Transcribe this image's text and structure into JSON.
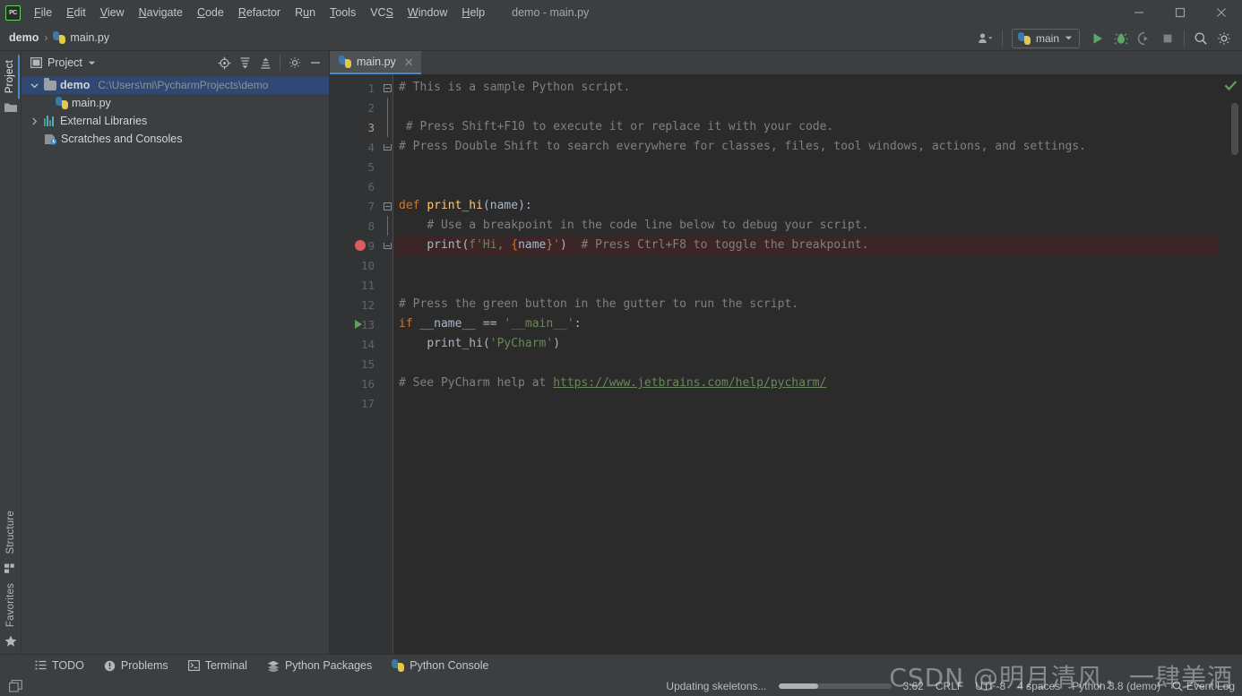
{
  "window": {
    "title": "demo - main.py",
    "logo_text": "PC",
    "controls": [
      {
        "name": "minimize",
        "label": "—"
      },
      {
        "name": "maximize",
        "label": "□"
      },
      {
        "name": "close",
        "label": "✕"
      }
    ]
  },
  "menu": {
    "items": [
      {
        "label": "File",
        "mnemonic": "F"
      },
      {
        "label": "Edit",
        "mnemonic": "E"
      },
      {
        "label": "View",
        "mnemonic": "V"
      },
      {
        "label": "Navigate",
        "mnemonic": "N"
      },
      {
        "label": "Code",
        "mnemonic": "C"
      },
      {
        "label": "Refactor",
        "mnemonic": "R"
      },
      {
        "label": "Run",
        "mnemonic": "u"
      },
      {
        "label": "Tools",
        "mnemonic": "T"
      },
      {
        "label": "VCS",
        "mnemonic": "S"
      },
      {
        "label": "Window",
        "mnemonic": "W"
      },
      {
        "label": "Help",
        "mnemonic": "H"
      }
    ]
  },
  "breadcrumb": {
    "project": "demo",
    "separator": "›",
    "file": "main.py"
  },
  "toolbar": {
    "run_config": "main",
    "buttons": [
      {
        "name": "user-accounts-button",
        "label": "Accounts"
      },
      {
        "name": "run-button",
        "label": "Run"
      },
      {
        "name": "debug-button",
        "label": "Debug"
      },
      {
        "name": "run-with-coverage-button",
        "label": "Run with Coverage"
      },
      {
        "name": "stop-button",
        "label": "Stop"
      },
      {
        "name": "search-everywhere-button",
        "label": "Search Everywhere"
      },
      {
        "name": "settings-button",
        "label": "Settings"
      }
    ]
  },
  "left_rail": {
    "top_tab": "Project",
    "bottom_tabs": [
      "Structure",
      "Favorites"
    ]
  },
  "project_panel": {
    "title": "Project",
    "actions": [
      {
        "name": "select-opened-file-button",
        "label": "Select Opened File"
      },
      {
        "name": "expand-all-button",
        "label": "Expand All"
      },
      {
        "name": "collapse-all-button",
        "label": "Collapse All"
      },
      {
        "name": "panel-settings-button",
        "label": "Options"
      },
      {
        "name": "hide-panel-button",
        "label": "Hide"
      }
    ],
    "tree": [
      {
        "label": "demo",
        "path": "C:\\Users\\mi\\PycharmProjects\\demo",
        "icon": "folder-icon",
        "selected": true,
        "expanded": true,
        "indent": 0
      },
      {
        "label": "main.py",
        "path": "",
        "icon": "python-file-icon",
        "selected": false,
        "expanded": null,
        "indent": 1
      },
      {
        "label": "External Libraries",
        "path": "",
        "icon": "library-icon",
        "selected": false,
        "expanded": false,
        "indent": 0
      },
      {
        "label": "Scratches and Consoles",
        "path": "",
        "icon": "scratches-icon",
        "selected": false,
        "expanded": null,
        "indent": 0
      }
    ]
  },
  "editor": {
    "tabs": [
      {
        "label": "main.py",
        "icon": "python-file-icon",
        "active": true,
        "close": "✕"
      }
    ],
    "inspection_status": "ok",
    "lines": [
      {
        "n": "1",
        "fold": "top",
        "bp": false,
        "run": false
      },
      {
        "n": "2",
        "fold": "line",
        "bp": false,
        "run": false
      },
      {
        "n": "3",
        "fold": "line",
        "bp": false,
        "run": false
      },
      {
        "n": "4",
        "fold": "bottom",
        "bp": false,
        "run": false
      },
      {
        "n": "5",
        "fold": "none",
        "bp": false,
        "run": false
      },
      {
        "n": "6",
        "fold": "none",
        "bp": false,
        "run": false
      },
      {
        "n": "7",
        "fold": "top",
        "bp": false,
        "run": false
      },
      {
        "n": "8",
        "fold": "line",
        "bp": false,
        "run": false
      },
      {
        "n": "9",
        "fold": "bottom",
        "bp": true,
        "run": false
      },
      {
        "n": "10",
        "fold": "none",
        "bp": false,
        "run": false
      },
      {
        "n": "11",
        "fold": "none",
        "bp": false,
        "run": false
      },
      {
        "n": "12",
        "fold": "none",
        "bp": false,
        "run": false
      },
      {
        "n": "13",
        "fold": "none",
        "bp": false,
        "run": true
      },
      {
        "n": "14",
        "fold": "none",
        "bp": false,
        "run": false
      },
      {
        "n": "15",
        "fold": "none",
        "bp": false,
        "run": false
      },
      {
        "n": "16",
        "fold": "none",
        "bp": false,
        "run": false
      },
      {
        "n": "17",
        "fold": "none",
        "bp": false,
        "run": false
      }
    ],
    "code": {
      "l1": "# This is a sample Python script.",
      "l3": "# Press Shift+F10 to execute it or replace it with your code.",
      "l4": "# Press Double Shift to search everywhere for classes, files, tool windows, actions, and settings.",
      "l7_kw": "def",
      "l7_fn": "print_hi",
      "l7_rest": "(name):",
      "l8": "# Use a breakpoint in the code line below to debug your script.",
      "l9_call": "print(",
      "l9_f": "f'Hi, ",
      "l9_brace_open": "{",
      "l9_name": "name",
      "l9_brace_close": "}",
      "l9_strend": "'",
      "l9_paren": ")",
      "l9_cmt": "# Press Ctrl+F8 to toggle the breakpoint.",
      "l12": "# Press the green button in the gutter to run the script.",
      "l13_kw": "if",
      "l13_var": " __name__ == ",
      "l13_str": "'__main__'",
      "l13_colon": ":",
      "l14_fn": "print_hi",
      "l14_open": "(",
      "l14_str": "'PyCharm'",
      "l14_close": ")",
      "l16_cmt": "# See PyCharm help at ",
      "l16_link": "https://www.jetbrains.com/help/pycharm/"
    }
  },
  "bottom_bar": {
    "items": [
      {
        "label": "TODO",
        "icon": "todo-icon"
      },
      {
        "label": "Problems",
        "icon": "problems-icon"
      },
      {
        "label": "Terminal",
        "icon": "terminal-icon"
      },
      {
        "label": "Python Packages",
        "icon": "packages-icon"
      },
      {
        "label": "Python Console",
        "icon": "python-console-icon"
      }
    ]
  },
  "status_bar": {
    "progress_label": "Updating skeletons...",
    "progress_percent": 35,
    "caret_position": "3:62",
    "line_separator": "CRLF",
    "encoding": "UTF-8",
    "indent": "4 spaces",
    "interpreter": "Python 3.8 (demo)",
    "event_log": "Event Log"
  },
  "watermark": "CSDN @明月清风，一肆美酒",
  "colors": {
    "chrome": "#3c3f41",
    "editor_bg": "#2b2b2b",
    "gutter_bg": "#313335",
    "accent_blue": "#4a88c7",
    "selection_blue": "#2f4974",
    "breakpoint_red": "#db5c5c",
    "breakpoint_line": "#3b2526",
    "run_green": "#5fa05f",
    "comment": "#808080",
    "keyword": "#cc7832",
    "string": "#6a8759",
    "function": "#ffc66d",
    "text": "#a9b7c6"
  }
}
